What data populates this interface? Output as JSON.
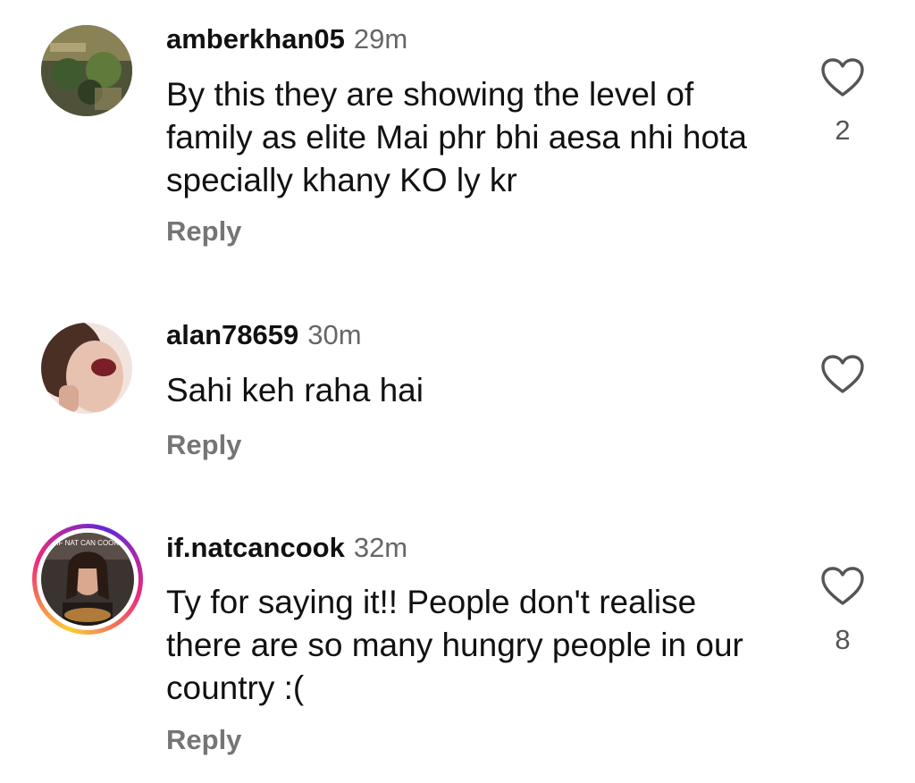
{
  "comments": [
    {
      "username": "amberkhan05",
      "time": "29m",
      "text": "By this they are showing the level of family as elite Mai phr bhi aesa nhi hota specially khany KO ly kr",
      "reply_label": "Reply",
      "like_count": "2",
      "like_icon": "heart-outline-icon"
    },
    {
      "username": "alan78659",
      "time": "30m",
      "text": "Sahi keh raha hai",
      "reply_label": "Reply",
      "like_count": "",
      "like_icon": "heart-outline-icon"
    },
    {
      "username": "if.natcancook",
      "time": "32m",
      "text": "Ty for saying it!! People don't realise there are so many hungry people in our country :(",
      "reply_label": "Reply",
      "like_count": "8",
      "like_icon": "heart-outline-icon",
      "avatar_caption": "IF NAT CAN COOK",
      "has_story_ring": true
    }
  ]
}
